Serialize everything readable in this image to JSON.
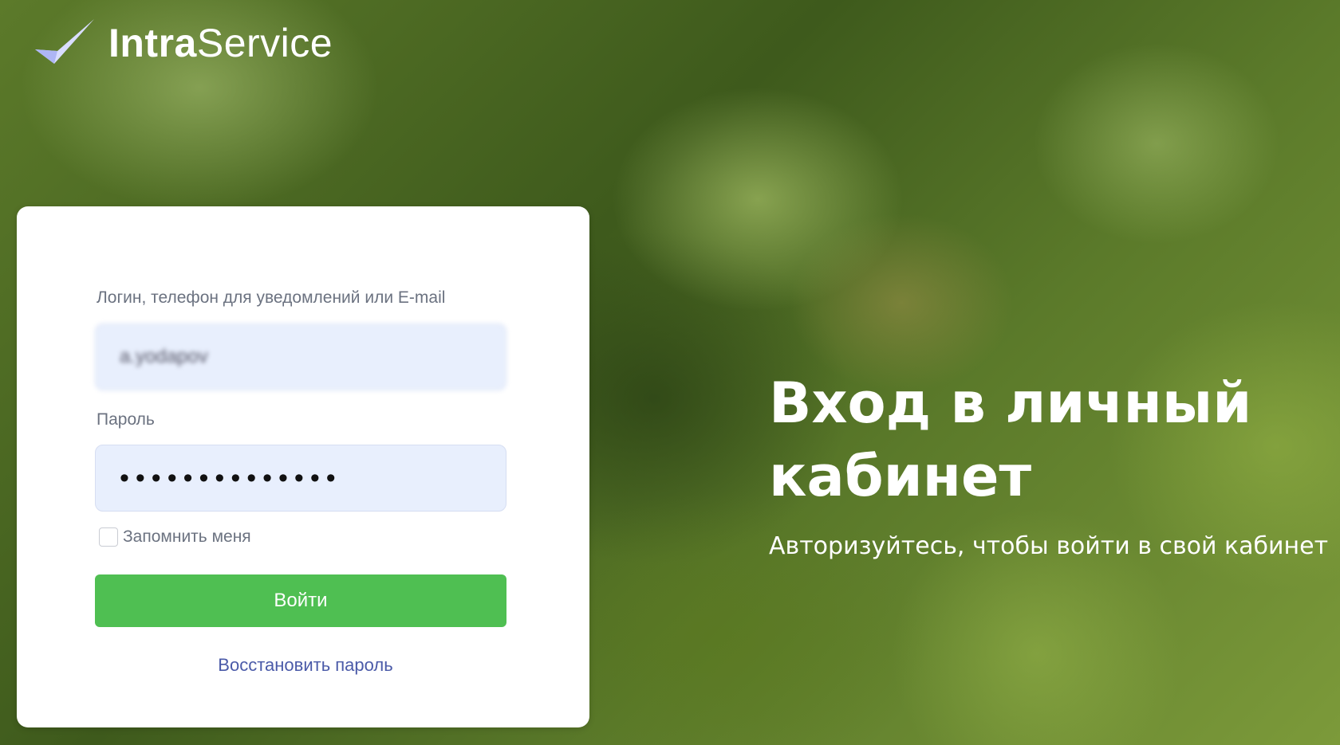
{
  "app": {
    "logo_part_bold": "Intra",
    "logo_part_regular": "Service",
    "logo_icon": "checkmark-icon"
  },
  "login_form": {
    "login_label": "Логин, телефон для уведомлений или E-mail",
    "login_value": "a.yodapov",
    "password_label": "Пароль",
    "password_value": "••••••••••••••",
    "remember_label": "Запомнить меня",
    "remember_checked": false,
    "submit_label": "Войти",
    "restore_link": "Восстановить пароль"
  },
  "hero": {
    "title": "Вход в личный кабинет",
    "subtitle": "Авторизуйтесь, чтобы войти в свой кабинет"
  },
  "colors": {
    "submit_button": "#4fbf52",
    "input_background": "#e8effd",
    "link": "#4a5aa8",
    "logo_check": "#cfd6ff"
  }
}
